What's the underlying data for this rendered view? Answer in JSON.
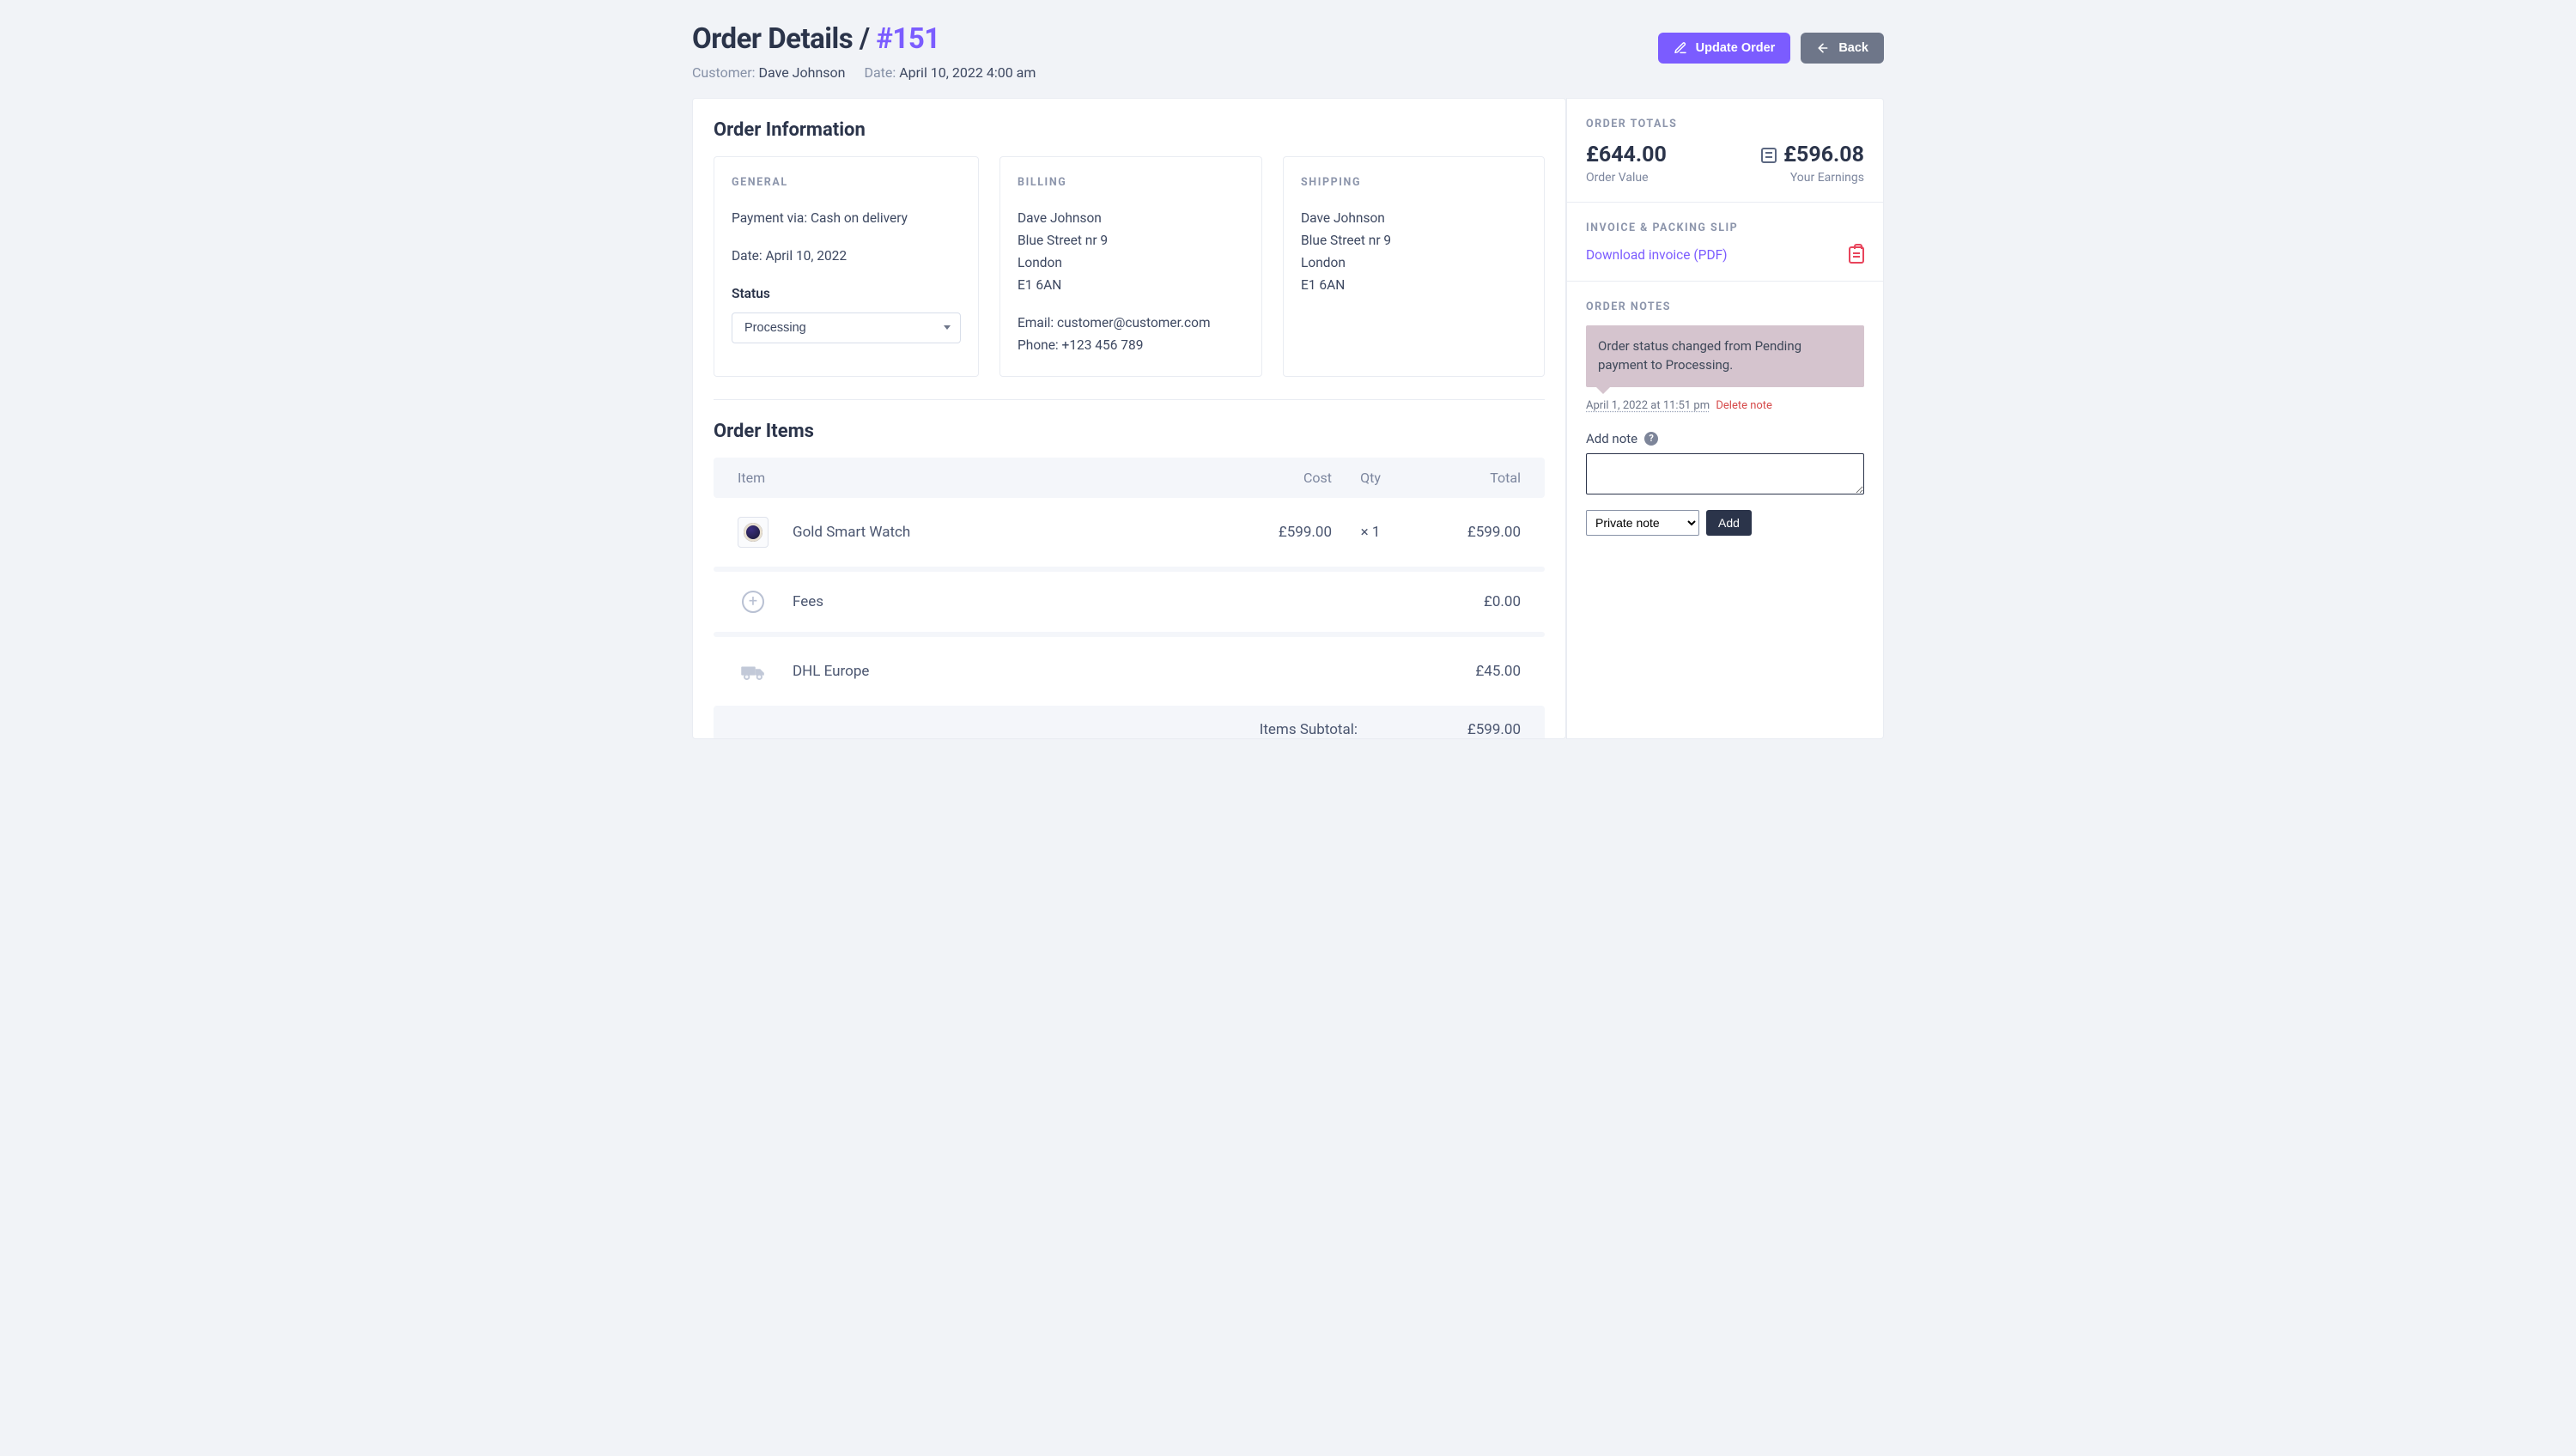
{
  "header": {
    "title_prefix": "Order Details /",
    "order_id": "#151",
    "customer_label": "Customer:",
    "customer_name": "Dave Johnson",
    "date_label": "Date:",
    "date_value": "April 10, 2022 4:00 am",
    "update_label": "Update Order",
    "back_label": "Back"
  },
  "info": {
    "section_title": "Order Information",
    "general": {
      "label": "GENERAL",
      "payment_line": "Payment via: Cash on delivery",
      "date_line": "Date: April 10, 2022",
      "status_label": "Status",
      "status_value": "Processing"
    },
    "billing": {
      "label": "BILLING",
      "name": "Dave Johnson",
      "street": "Blue Street nr 9",
      "city": "London",
      "zip": "E1 6AN",
      "email_line": "Email: customer@customer.com",
      "phone_line": "Phone: +123 456 789"
    },
    "shipping": {
      "label": "SHIPPING",
      "name": "Dave Johnson",
      "street": "Blue Street nr 9",
      "city": "London",
      "zip": "E1 6AN"
    }
  },
  "items": {
    "section_title": "Order Items",
    "columns": {
      "item": "Item",
      "cost": "Cost",
      "qty": "Qty",
      "total": "Total"
    },
    "rows": [
      {
        "name": "Gold Smart Watch",
        "cost": "£599.00",
        "qty": "× 1",
        "total": "£599.00",
        "kind": "product"
      },
      {
        "name": "Fees",
        "cost": "",
        "qty": "",
        "total": "£0.00",
        "kind": "fee"
      },
      {
        "name": "DHL Europe",
        "cost": "",
        "qty": "",
        "total": "£45.00",
        "kind": "shipping"
      }
    ],
    "subtotal_label": "Items Subtotal:",
    "subtotal_value": "£599.00"
  },
  "sidebar": {
    "totals": {
      "label": "ORDER TOTALS",
      "order_value": "£644.00",
      "order_value_label": "Order Value",
      "earnings": "£596.08",
      "earnings_label": "Your Earnings"
    },
    "invoice": {
      "label": "INVOICE & PACKING SLIP",
      "download_text": "Download invoice (PDF)"
    },
    "notes": {
      "label": "ORDER NOTES",
      "note_text": "Order status changed from Pending payment to Processing.",
      "note_time": "April 1, 2022 at 11:51 pm",
      "delete_text": "Delete note",
      "add_label": "Add note",
      "note_type": "Private note",
      "add_button": "Add"
    }
  }
}
